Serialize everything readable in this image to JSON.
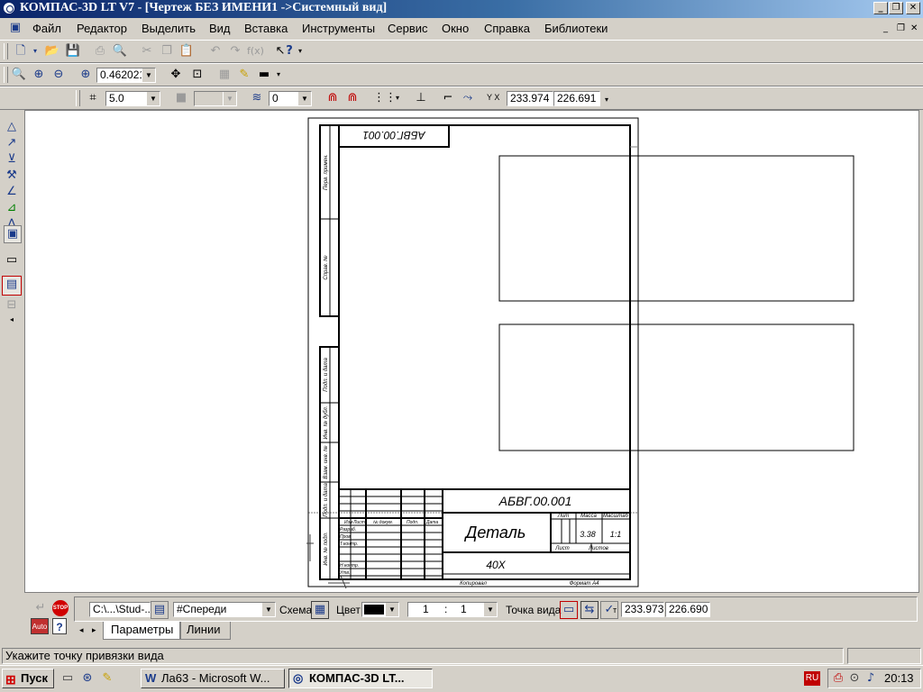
{
  "window": {
    "title": "КОМПАС-3D LT V7 - [Чертеж БЕЗ ИМЕНИ1 ->Системный вид]",
    "min_glyph": "_",
    "max_glyph": "❐",
    "close_glyph": "✕"
  },
  "menu": {
    "items": [
      "Файл",
      "Редактор",
      "Выделить",
      "Вид",
      "Вставка",
      "Инструменты",
      "Сервис",
      "Окно",
      "Справка",
      "Библиотеки"
    ],
    "mdi_min": "_",
    "mdi_restore": "❐",
    "mdi_close": "✕"
  },
  "toolbar_view": {
    "zoom_value": "0.462021"
  },
  "toolbar_params": {
    "step_value": "5.0",
    "style_value": "",
    "layer_value": "0",
    "coord_x": "233.974",
    "coord_y": "226.691",
    "coord_icon": "Y X"
  },
  "drawing": {
    "designation_stamp": "АБВГ.00.001",
    "designation": "АБВГ.00.001",
    "part_name": "Деталь",
    "material": "40Х",
    "mass": "3.38",
    "scale": "1:1",
    "col_lit": "Лит",
    "col_mass": "Масса",
    "col_scale": "Масштаб",
    "row_izm": "Изм",
    "row_list": "Лист",
    "row_doc": "№ докум.",
    "row_sign": "Подп.",
    "row_date": "Дата",
    "row_razrab": "Разраб.",
    "row_prov": "Пров.",
    "row_tkontr": "Т.контр.",
    "row_nkontr": "Н.контр.",
    "row_utv": "Утв.",
    "sheet_label": "Лист",
    "sheets_label": "Листов",
    "copied": "Копировал",
    "format": "Формат   А4",
    "side_labels": [
      "Перв. примен.",
      "Справ. №",
      "Подп. и дата",
      "Инв. № дубл.",
      "Взам. инв. №",
      "Подп. и дата",
      "Инв. № подл."
    ]
  },
  "bottom": {
    "path_value": "C:\\...\\Stud-...",
    "view_value": "#Спереди",
    "schema_label": "Схема",
    "color_label": "Цвет",
    "scale_left": "1",
    "scale_sep": ":",
    "scale_right": "1",
    "viewpoint_label": "Точка вида",
    "point_x": "233.973",
    "point_y": "226.690",
    "stop_label": "STOP",
    "auto_label": "Auto",
    "help_label": "?",
    "tab_params": "Параметры",
    "tab_lines": "Линии"
  },
  "status": {
    "text": "Укажите точку привязки вида"
  },
  "taskbar": {
    "start": "Пуск",
    "task1": "Ла63 - Microsoft W...",
    "task2": "КОМПАС-3D LT...",
    "lang": "RU",
    "clock": "20:13"
  }
}
